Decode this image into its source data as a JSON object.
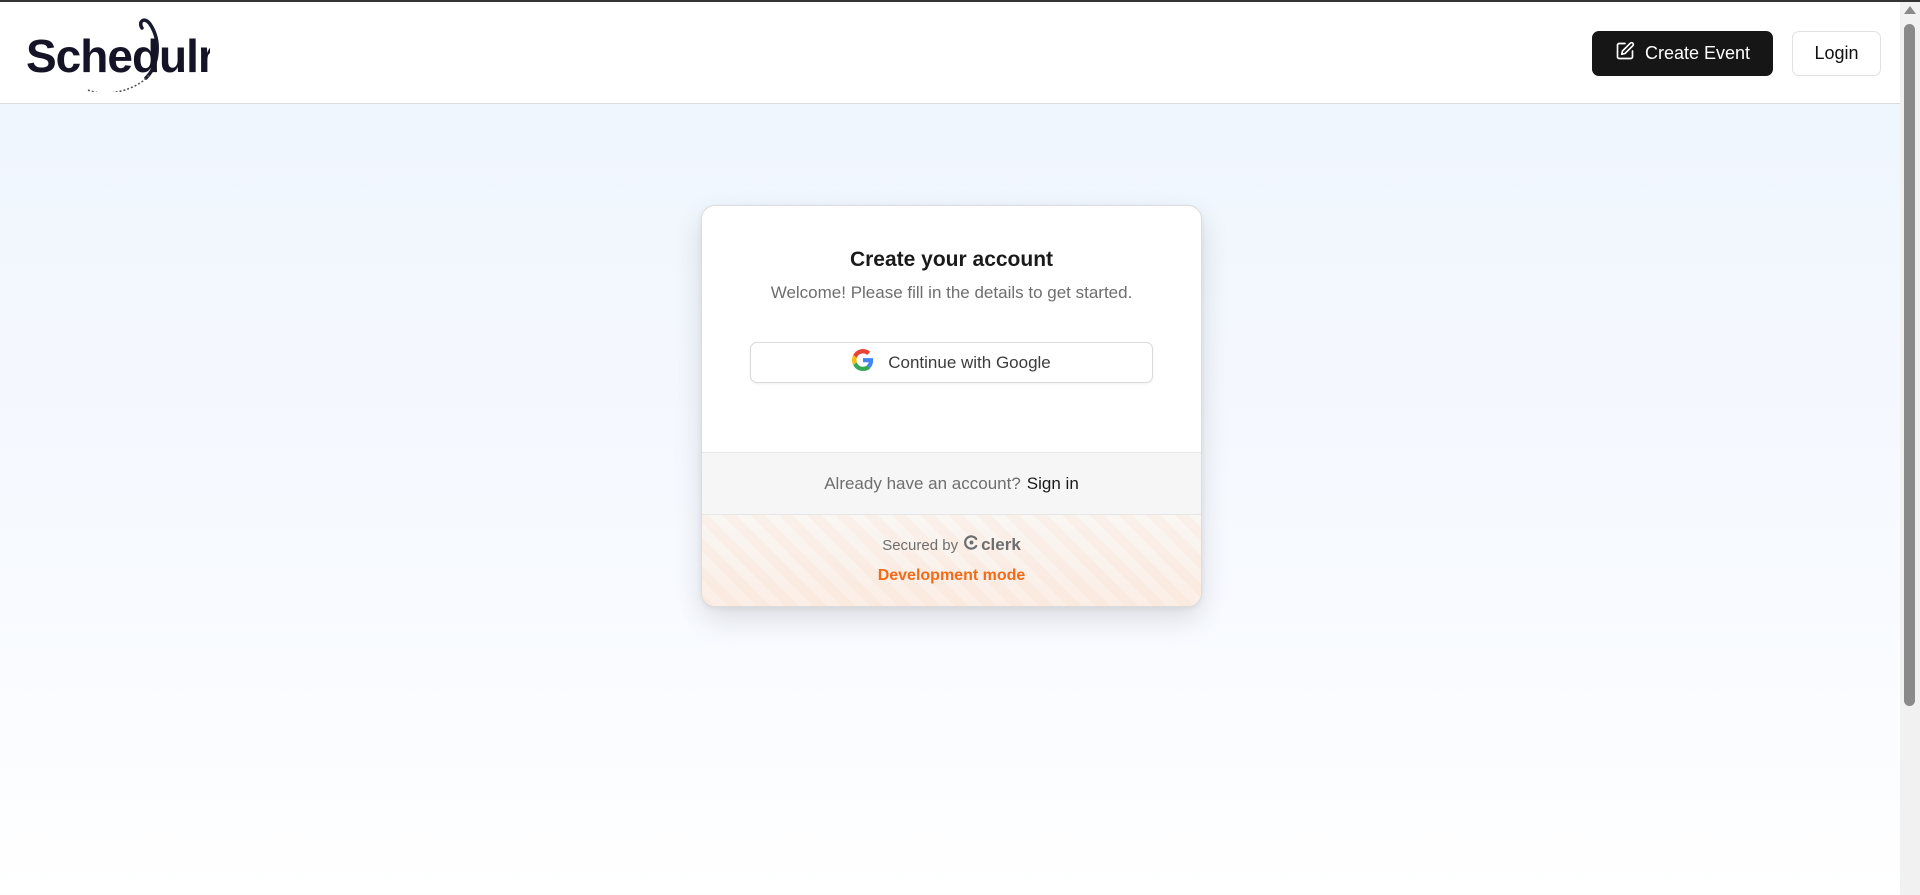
{
  "header": {
    "logo_text": "Schedulrr",
    "create_event_label": "Create Event",
    "login_label": "Login"
  },
  "signup": {
    "title": "Create your account",
    "subtitle": "Welcome! Please fill in the details to get started.",
    "google_button_label": "Continue with Google",
    "already_text": "Already have an account?",
    "sign_in_label": "Sign in"
  },
  "footer": {
    "secured_by": "Secured by",
    "brand": "clerk",
    "dev_mode": "Development mode"
  },
  "colors": {
    "primary_button": "#161616",
    "dev_mode": "#f36b16",
    "page_background": "#eef5fe"
  },
  "icons": {
    "create_event": "edit-square-icon",
    "google": "google-logo-icon",
    "clerk": "clerk-logo-icon"
  }
}
